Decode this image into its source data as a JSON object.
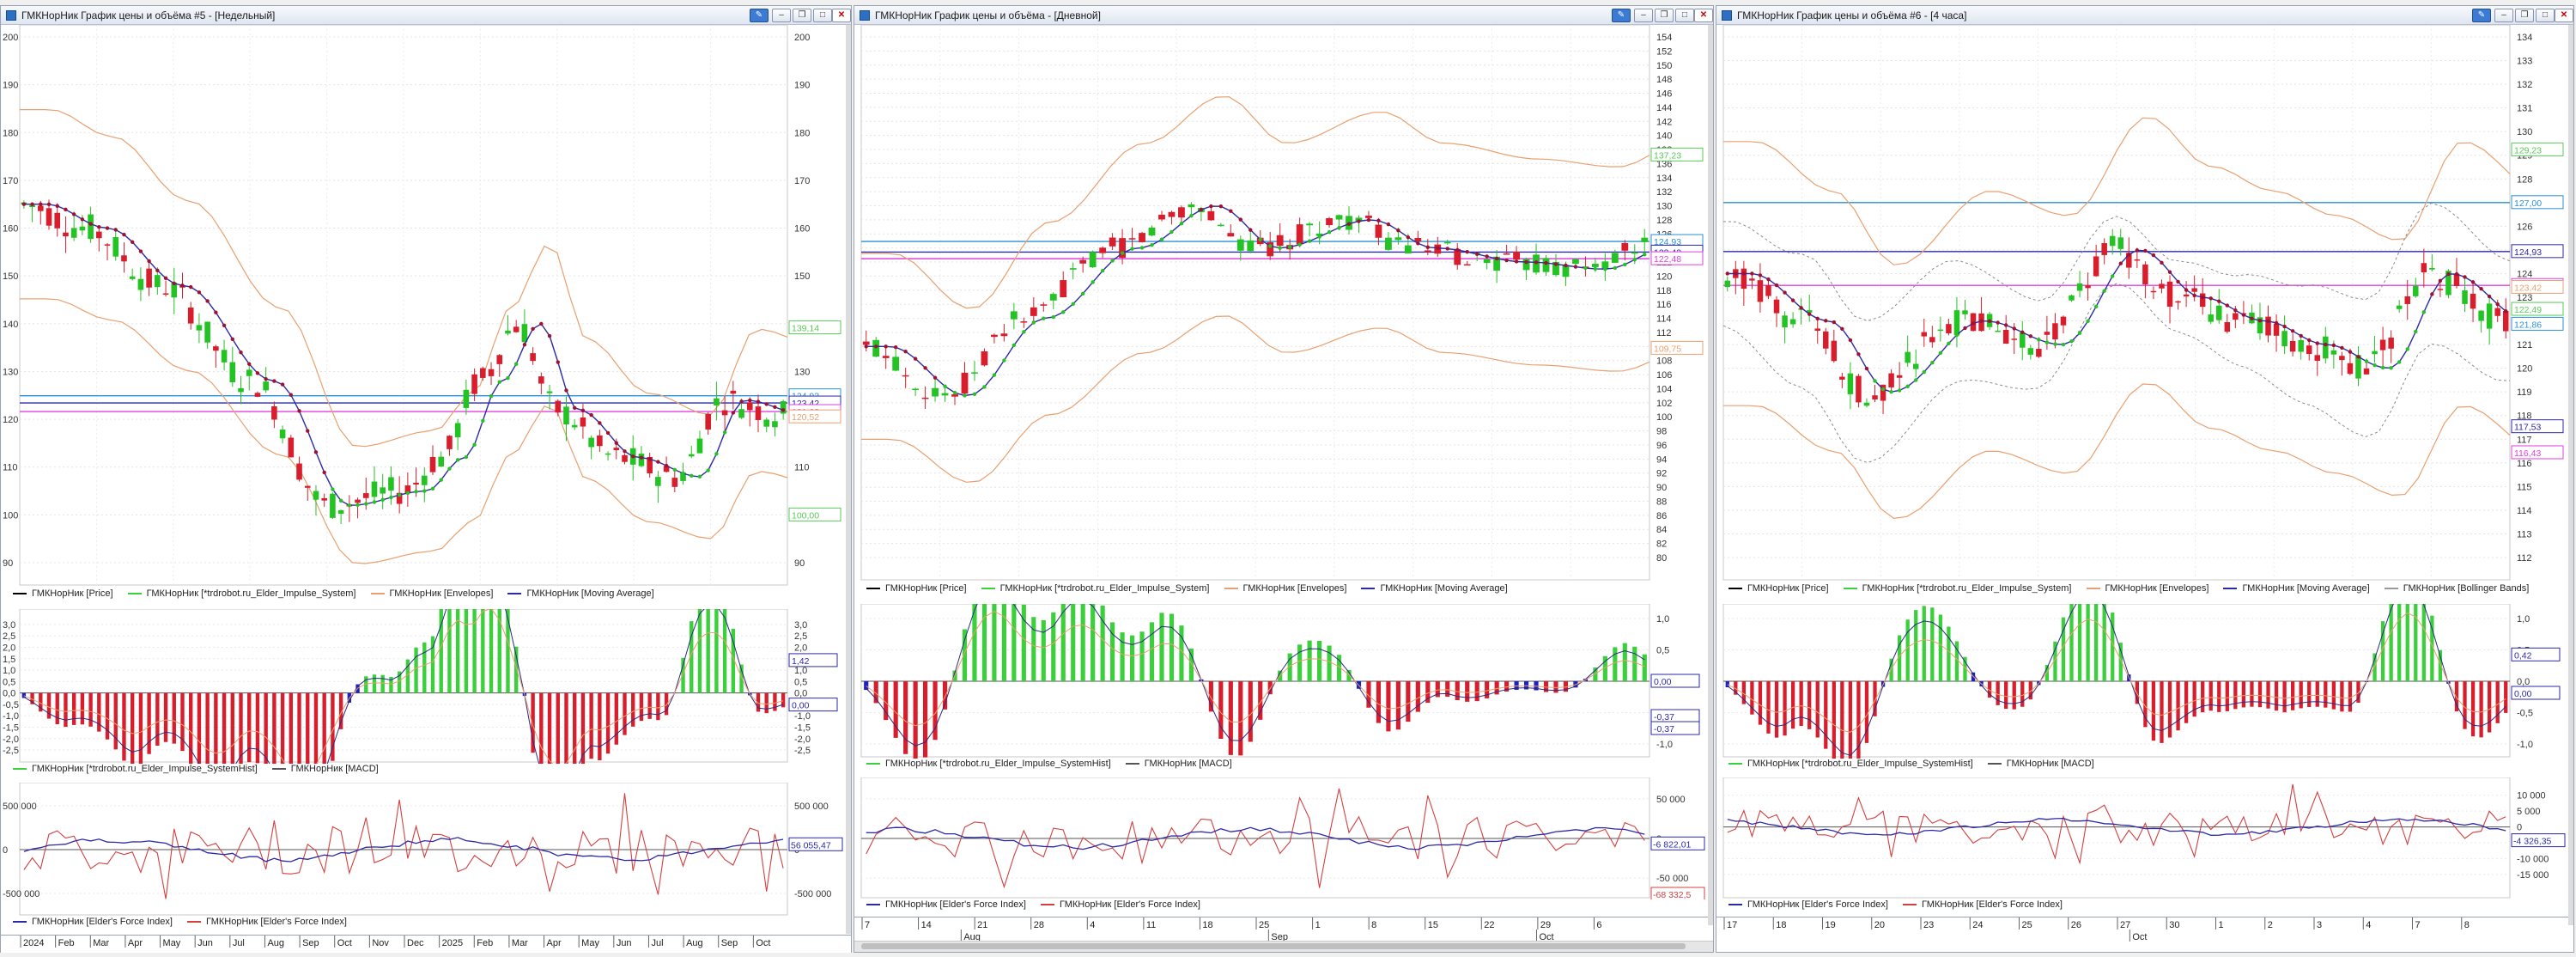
{
  "windows": [
    {
      "title": "ГМКНорНик График цены и объёма #5 - [Недельный]",
      "price": {
        "ticks": [
          "200",
          "190",
          "180",
          "170",
          "160",
          "150",
          "140",
          "130",
          "120",
          "110",
          "100",
          "90"
        ],
        "tags": [
          "139,14",
          "124,93",
          "123,42",
          "121,63",
          "120,52",
          "100,00"
        ],
        "legend": [
          "ГМКНорНик [Price]",
          "ГМКНорНик [*trdrobot.ru_Elder_Impulse_System]",
          "ГМКНорНик [Envelopes]",
          "ГМКНорНик [Moving Average]"
        ]
      },
      "macd": {
        "ticks": [
          "3,0",
          "2,5",
          "2,0",
          "1,5",
          "1,0",
          "0,5",
          "0,0",
          "-0,5",
          "-1,0",
          "-1,5",
          "-2,0",
          "-2,5"
        ],
        "tags": [
          "1,42",
          "0,00"
        ],
        "legend": [
          "ГМКНорНик [*trdrobot.ru_Elder_Impulse_SystemHist]",
          "ГМКНорНик [MACD]"
        ]
      },
      "force": {
        "ticks": [
          "500 000",
          "0",
          "-500 000"
        ],
        "tags": [
          "56 055,47"
        ],
        "legend": [
          "ГМКНорНик [Elder's Force Index]",
          "ГМКНорНик [Elder's Force Index]"
        ]
      },
      "dates_top": [
        "2024",
        "Feb",
        "Mar",
        "Apr",
        "May",
        "Jun",
        "Jul",
        "Aug",
        "Sep",
        "Oct",
        "Nov",
        "Dec",
        "2025",
        "Feb",
        "Mar",
        "Apr",
        "May",
        "Jun",
        "Jul",
        "Aug",
        "Sep",
        "Oct"
      ],
      "dates_bottom": []
    },
    {
      "title": "ГМКНорНик График цены и объёма - [Дневной]",
      "price": {
        "ticks": [
          "154",
          "152",
          "150",
          "148",
          "146",
          "144",
          "142",
          "140",
          "138",
          "136",
          "134",
          "132",
          "130",
          "128",
          "126",
          "124",
          "122",
          "120",
          "118",
          "116",
          "114",
          "112",
          "110",
          "108",
          "106",
          "104",
          "102",
          "100",
          "98",
          "96",
          "94",
          "92",
          "90",
          "88",
          "86",
          "84",
          "82",
          "80"
        ],
        "tags": [
          "137,23",
          "124,93",
          "123,42",
          "122,48",
          "109,75"
        ],
        "legend": [
          "ГМКНорНик [Price]",
          "ГМКНорНик [*trdrobot.ru_Elder_Impulse_System]",
          "ГМКНорНик [Envelopes]",
          "ГМКНорНик [Moving Average]"
        ]
      },
      "macd": {
        "ticks": [
          "1,0",
          "0,5",
          "0,0",
          "-0,5",
          "-1,0"
        ],
        "tags": [
          "0,00",
          "-0,37",
          "-0,37"
        ],
        "legend": [
          "ГМКНорНик [*trdrobot.ru_Elder_Impulse_SystemHist]",
          "ГМКНорНик [MACD]"
        ]
      },
      "force": {
        "ticks": [
          "50 000",
          "0",
          "-50 000"
        ],
        "tags": [
          "-6 822,01",
          "-68 332,5"
        ],
        "legend": [
          "ГМКНорНик [Elder's Force Index]",
          "ГМКНорНик [Elder's Force Index]"
        ]
      },
      "dates_top": [
        "7",
        "14",
        "21",
        "28",
        "4",
        "11",
        "18",
        "25",
        "1",
        "8",
        "15",
        "22",
        "29",
        "6"
      ],
      "dates_bottom": [
        "Aug",
        "Sep",
        "Oct"
      ]
    },
    {
      "title": "ГМКНорНик График цены и объёма #6 - [4 часа]",
      "price": {
        "ticks": [
          "134",
          "133",
          "132",
          "131",
          "130",
          "129",
          "128",
          "127",
          "126",
          "125",
          "124",
          "123",
          "122",
          "121",
          "120",
          "119",
          "118",
          "117",
          "116",
          "115",
          "114",
          "113",
          "112"
        ],
        "tags": [
          "129,23",
          "127,00",
          "124,93",
          "123,50",
          "123,42",
          "122,49",
          "121,86",
          "117,53",
          "116,43"
        ],
        "legend": [
          "ГМКНорНик [Price]",
          "ГМКНорНик [*trdrobot.ru_Elder_Impulse_System]",
          "ГМКНорНик [Envelopes]",
          "ГМКНорНик [Moving Average]",
          "ГМКНорНик [Bollinger Bands]"
        ]
      },
      "macd": {
        "ticks": [
          "1,0",
          "0,5",
          "0,0",
          "-0,5",
          "-1,0"
        ],
        "tags": [
          "0,42",
          "0,00"
        ],
        "legend": [
          "ГМКНорНик [*trdrobot.ru_Elder_Impulse_SystemHist]",
          "ГМКНорНик [MACD]"
        ]
      },
      "force": {
        "ticks": [
          "10 000",
          "5 000",
          "0",
          "-5 000",
          "-10 000",
          "-15 000"
        ],
        "tags": [
          "-4 326,35"
        ],
        "legend": [
          "ГМКНорНик [Elder's Force Index]",
          "ГМКНорНик [Elder's Force Index]"
        ]
      },
      "dates_top": [
        "17",
        "18",
        "19",
        "20",
        "23",
        "24",
        "25",
        "26",
        "27",
        "30",
        "1",
        "2",
        "3",
        "4",
        "7",
        "8"
      ],
      "dates_bottom": [
        "Oct"
      ]
    }
  ]
}
